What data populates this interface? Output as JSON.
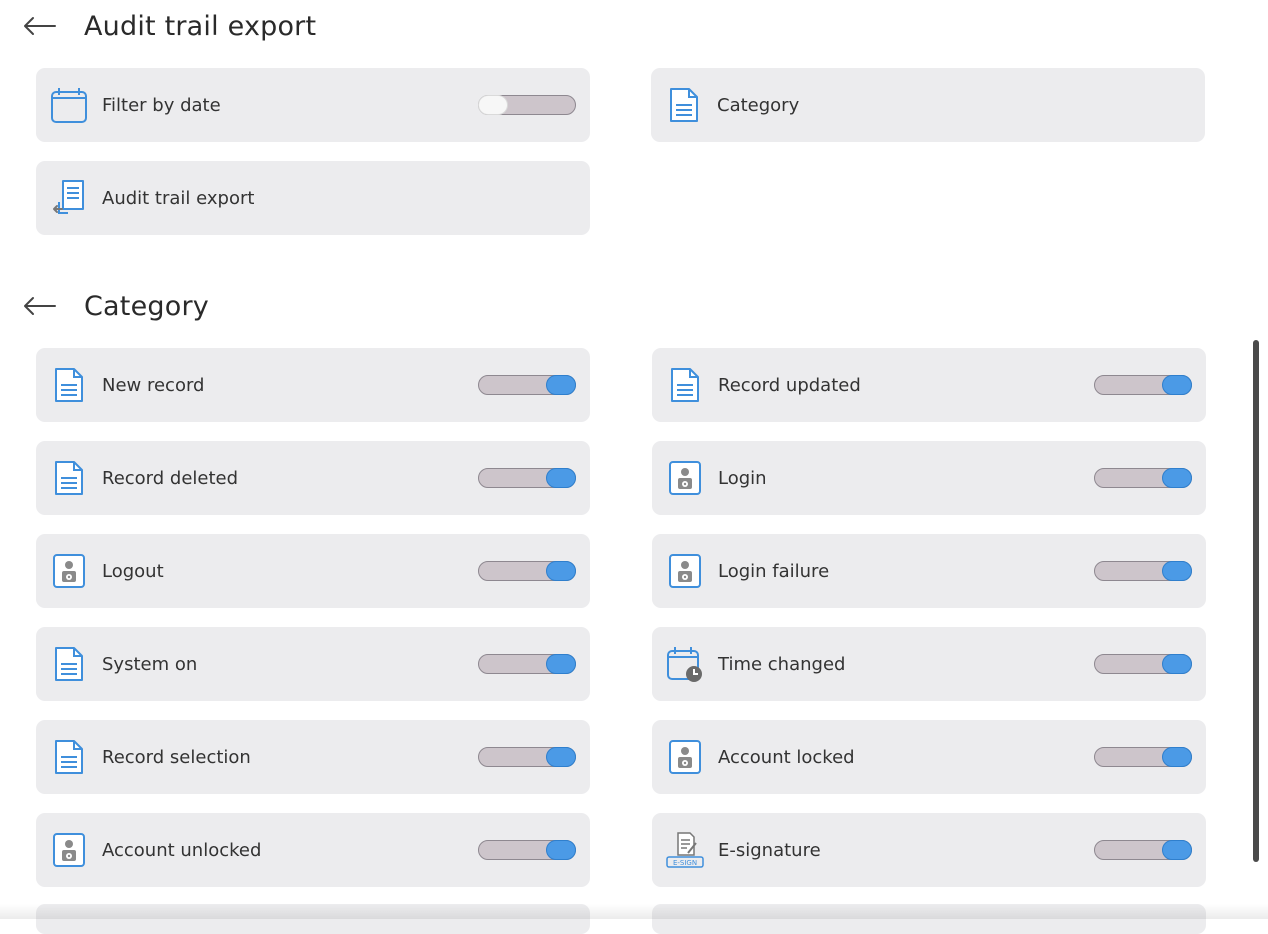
{
  "header1": {
    "title": "Audit trail export"
  },
  "top_items": {
    "filter_by_date": {
      "label": "Filter by date",
      "icon": "calendar-icon",
      "enabled": false
    },
    "category": {
      "label": "Category",
      "icon": "document-icon"
    },
    "audit_trail_export": {
      "label": "Audit trail export",
      "icon": "export-document-icon"
    }
  },
  "header2": {
    "title": "Category"
  },
  "categories": [
    {
      "label": "New record",
      "icon": "document-icon",
      "enabled": true
    },
    {
      "label": "Record updated",
      "icon": "document-icon",
      "enabled": true
    },
    {
      "label": "Record deleted",
      "icon": "document-icon",
      "enabled": true
    },
    {
      "label": "Login",
      "icon": "user-badge-icon",
      "enabled": true
    },
    {
      "label": "Logout",
      "icon": "user-badge-icon",
      "enabled": true
    },
    {
      "label": "Login failure",
      "icon": "user-badge-icon",
      "enabled": true
    },
    {
      "label": "System on",
      "icon": "document-icon",
      "enabled": true
    },
    {
      "label": "Time changed",
      "icon": "calendar-clock-icon",
      "enabled": true
    },
    {
      "label": "Record selection",
      "icon": "document-icon",
      "enabled": true
    },
    {
      "label": "Account locked",
      "icon": "user-badge-icon",
      "enabled": true
    },
    {
      "label": "Account unlocked",
      "icon": "user-badge-icon",
      "enabled": true
    },
    {
      "label": "E-signature",
      "icon": "e-sign-icon",
      "enabled": true
    }
  ],
  "icons": {
    "esign_text": "E-SIGN"
  },
  "colors": {
    "toggle_on": "#4b9ae6",
    "icon_blue": "#3f8fdc",
    "card_bg": "#ececee"
  }
}
